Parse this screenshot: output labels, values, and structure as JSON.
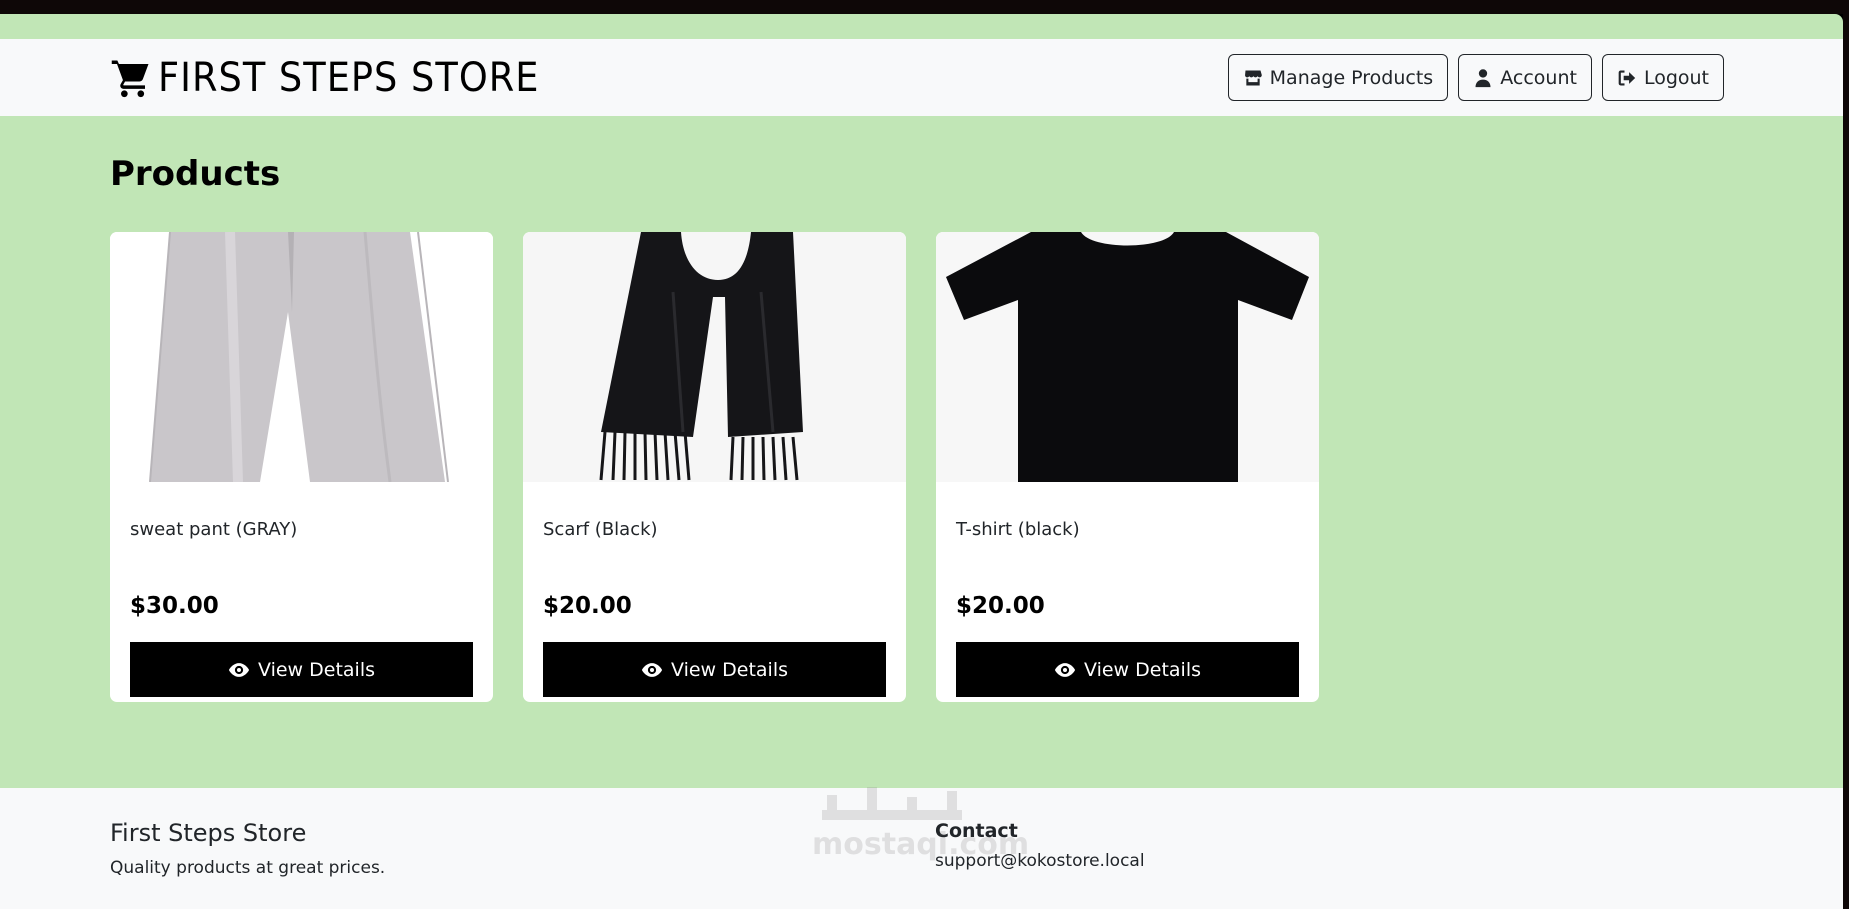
{
  "header": {
    "brand": "FIRST STEPS STORE",
    "buttons": {
      "manage": "Manage Products",
      "account": "Account",
      "logout": "Logout"
    }
  },
  "main": {
    "title": "Products",
    "products": [
      {
        "name": "sweat pant (GRAY)",
        "price": "$30.00",
        "button": "View Details"
      },
      {
        "name": "Scarf (Black)",
        "price": "$20.00",
        "button": "View Details"
      },
      {
        "name": "T-shirt (black)",
        "price": "$20.00",
        "button": "View Details"
      }
    ]
  },
  "footer": {
    "store_name": "First Steps Store",
    "tagline": "Quality products at great prices.",
    "contact_heading": "Contact",
    "contact_email": "support@kokostore.local"
  },
  "watermark": {
    "text": "mostaqi.com"
  },
  "colors": {
    "page_background": "#c1e6b6",
    "navbar": "#f8f9fa",
    "card_button": "#000000"
  },
  "icons": {
    "brand": "cart-icon",
    "manage": "store-icon",
    "account": "user-icon",
    "logout": "logout-icon",
    "view": "eye-icon"
  }
}
